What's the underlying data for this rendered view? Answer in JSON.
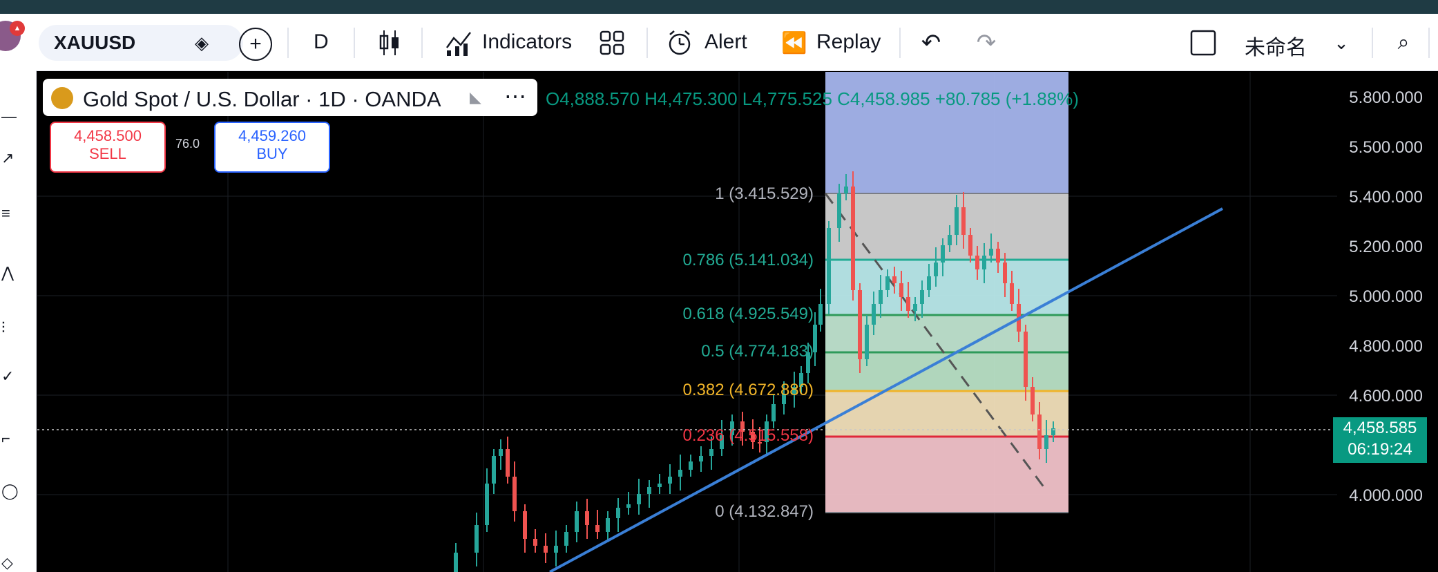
{
  "toolbar": {
    "symbol": "XAUUSD",
    "interval": "D",
    "indicators_label": "Indicators",
    "alert_label": "Alert",
    "replay_label": "Replay",
    "layout_name": "未命名"
  },
  "legend": {
    "title": "Gold Spot / U.S. Dollar · 1D · OANDA",
    "ohlc": "O4,888.570 H4,475.300 L4,775.525 C4,458.985 +80.785 (+1.88%)"
  },
  "trade": {
    "sell_price": "4,458.500",
    "sell_label": "SELL",
    "spread": "76.0",
    "buy_price": "4,459.260",
    "buy_label": "BUY"
  },
  "price_axis": {
    "labels": [
      "5.800.000",
      "5.500.000",
      "5.400.000",
      "5.200.000",
      "5.000.000",
      "4.800.000",
      "4.600.000",
      "4.000.000"
    ],
    "current_price": "4,458.585",
    "countdown": "06:19:24"
  },
  "fib_levels": [
    {
      "label": "1 (3.415.529)",
      "color": "#b2b5be"
    },
    {
      "label": "0.786 (5.141.034)",
      "color": "#22ab94"
    },
    {
      "label": "0.618 (4.925.549)",
      "color": "#22ab94"
    },
    {
      "label": "0.5 (4.774.183)",
      "color": "#22ab94"
    },
    {
      "label": "0.382 (4.672.880)",
      "color": "#f0b429"
    },
    {
      "label": "0.236 (4.515.558)",
      "color": "#f23645"
    },
    {
      "label": "0 (4.132.847)",
      "color": "#b2b5be"
    }
  ],
  "colors": {
    "up": "#26a69a",
    "down": "#ef5350",
    "trendline": "#3a7fd6"
  }
}
